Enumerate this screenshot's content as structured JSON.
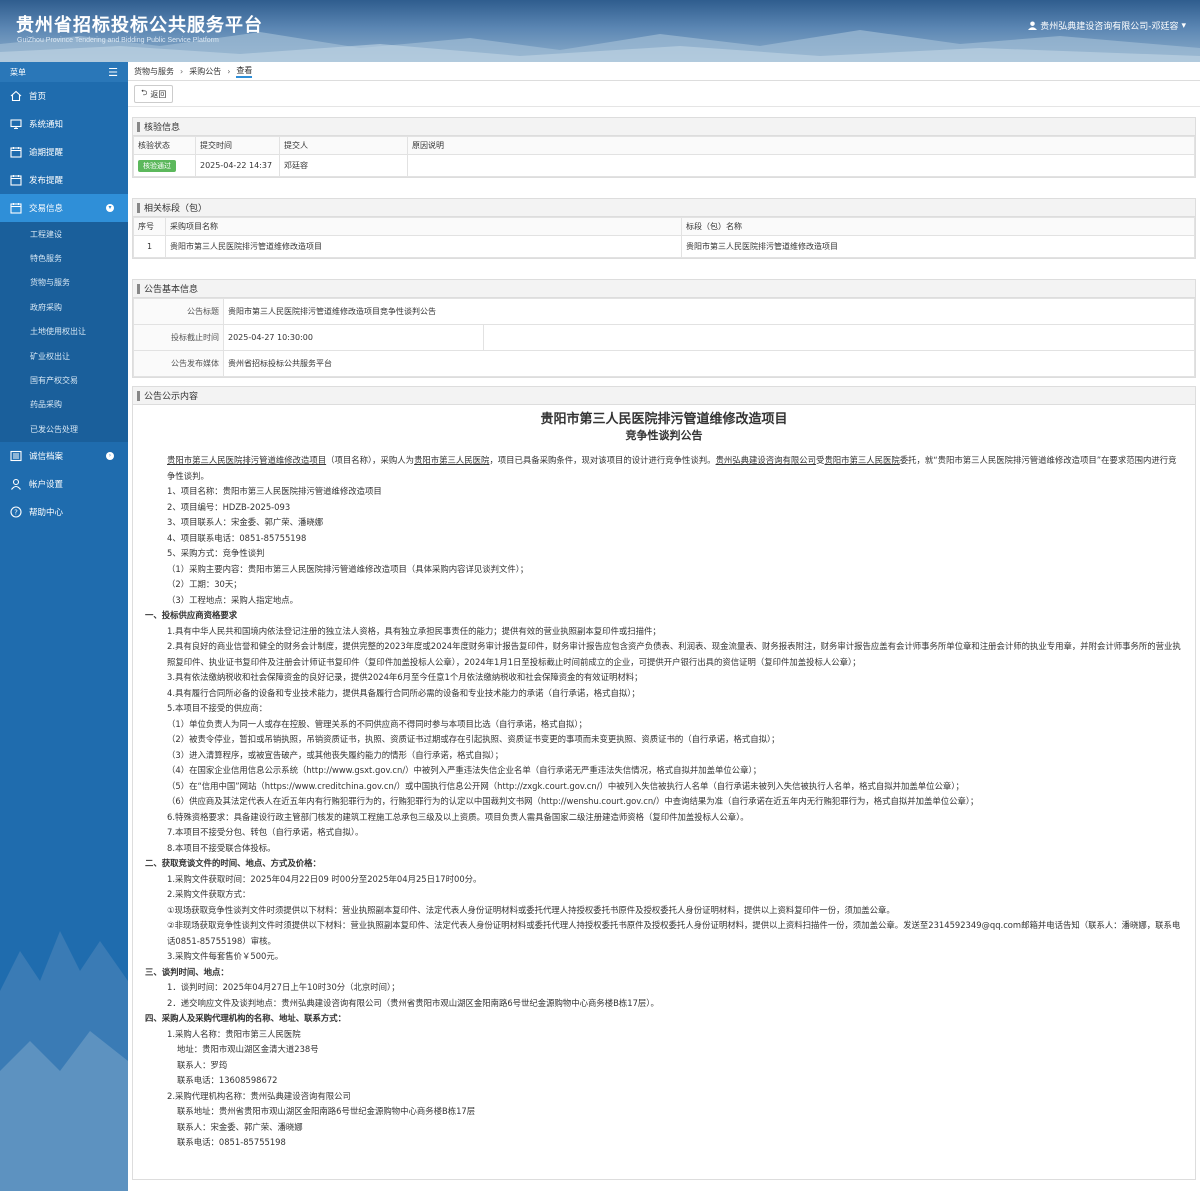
{
  "header": {
    "title_cn": "贵州省招标投标公共服务平台",
    "title_en": "GuiZhou Province Tendering and Bidding Public Service Platform",
    "user": "贵州弘典建设咨询有限公司-邓廷容"
  },
  "sidebar": {
    "menu_label": "菜单",
    "items": [
      {
        "label": "首页",
        "icon": "home-icon"
      },
      {
        "label": "系统通知",
        "icon": "monitor-icon"
      },
      {
        "label": "逾期提醒",
        "icon": "calendar-icon"
      },
      {
        "label": "发布提醒",
        "icon": "calendar-icon"
      },
      {
        "label": "交易信息",
        "icon": "calendar-icon"
      },
      {
        "label": "诚信档案",
        "icon": "list-icon"
      },
      {
        "label": "帐户设置",
        "icon": "user-icon"
      },
      {
        "label": "帮助中心",
        "icon": "help-icon"
      }
    ],
    "sub_items": [
      "工程建设",
      "特色服务",
      "货物与服务",
      "政府采购",
      "土地使用权出让",
      "矿业权出让",
      "国有产权交易",
      "药品采购",
      "已发公告处理"
    ]
  },
  "breadcrumb": [
    "货物与服务",
    "采购公告",
    "查看"
  ],
  "toolbar": {
    "back": "返回"
  },
  "verify": {
    "title": "核验信息",
    "headers": [
      "核验状态",
      "提交时间",
      "提交人",
      "原因说明"
    ],
    "status": "核验通过",
    "time": "2025-04-22 14:37",
    "person": "邓廷容",
    "reason": ""
  },
  "related": {
    "title": "相关标段（包）",
    "headers": [
      "序号",
      "采购项目名称",
      "标段（包）名称"
    ],
    "row": {
      "no": "1",
      "project": "贵阳市第三人民医院排污管道维修改造项目",
      "section": "贵阳市第三人民医院排污管道维修改造项目"
    }
  },
  "basic": {
    "title": "公告基本信息",
    "labels": [
      "公告标题",
      "投标截止时间",
      "公告发布媒体"
    ],
    "values": [
      "贵阳市第三人民医院排污管道维修改造项目竞争性谈判公告",
      "2025-04-27 10:30:00",
      "贵州省招标投标公共服务平台"
    ]
  },
  "notice": {
    "title": "公告公示内容",
    "h1": "贵阳市第三人民医院排污管道维修改造项目",
    "h2": "竞争性谈判公告",
    "intro": {
      "a": "贵阳市第三人民医院排污管道维修改造项目",
      "b": "（项目名称），采购人为",
      "c": "贵阳市第三人民医院",
      "d": "，项目已具备采购条件，现对该项目的设计进行竞争性谈判。",
      "e": "贵州弘典建设咨询有限公司",
      "f": "受",
      "g": "贵阳市第三人民医院",
      "h": "委托，就“贵阳市第三人民医院排污管道维修改造项目”在要求范围内进行竞争性谈判。"
    },
    "lines": [
      {
        "c": "i1",
        "t": "1、项目名称：贵阳市第三人民医院排污管道维修改造项目"
      },
      {
        "c": "i1",
        "t": "2、项目编号：HDZB-2025-093"
      },
      {
        "c": "i1",
        "t": "3、项目联系人：宋金委、郭广荣、潘晓娜"
      },
      {
        "c": "i1",
        "t": "4、项目联系电话：0851-85755198"
      },
      {
        "c": "i1",
        "t": "5、采购方式：竞争性谈判"
      },
      {
        "c": "i1",
        "t": "（1）采购主要内容：贵阳市第三人民医院排污管道维修改造项目（具体采购内容详见谈判文件）；"
      },
      {
        "c": "i1",
        "t": "（2）工期：30天；"
      },
      {
        "c": "i1",
        "t": "（3）工程地点：采购人指定地点。"
      },
      {
        "c": "b",
        "t": "一、投标供应商资格要求"
      },
      {
        "c": "i1",
        "t": "1.具有中华人民共和国境内依法登记注册的独立法人资格，具有独立承担民事责任的能力；提供有效的营业执照副本复印件或扫描件；"
      },
      {
        "c": "i1",
        "t": "2.具有良好的商业信誉和健全的财务会计制度，提供完整的2023年度或2024年度财务审计报告复印件，财务审计报告应包含资产负债表、利润表、现金流量表、财务报表附注，财务审计报告应盖有会计师事务所单位章和注册会计师的执业专用章，并附会计师事务所的营业执照复印件、执业证书复印件及注册会计师证书复印件（复印件加盖投标人公章），2024年1月1日至投标截止时间前成立的企业，可提供开户银行出具的资信证明（复印件加盖投标人公章）；"
      },
      {
        "c": "i1",
        "t": "3.具有依法缴纳税收和社会保障资金的良好记录，提供2024年6月至今任意1个月依法缴纳税收和社会保障资金的有效证明材料；"
      },
      {
        "c": "i1",
        "t": "4.具有履行合同所必备的设备和专业技术能力，提供具备履行合同所必需的设备和专业技术能力的承诺（自行承诺，格式自拟）；"
      },
      {
        "c": "i1",
        "t": "5.本项目不接受的供应商："
      },
      {
        "c": "i1",
        "t": "（1）单位负责人为同一人或存在控股、管理关系的不同供应商不得同时参与本项目比选（自行承诺，格式自拟）；"
      },
      {
        "c": "i1",
        "t": "（2）被责令停业，暂扣或吊销执照，吊销资质证书，执照、资质证书过期或存在引起执照、资质证书变更的事项而未变更执照、资质证书的（自行承诺，格式自拟）；"
      },
      {
        "c": "i1",
        "t": "（3）进入清算程序，或被宣告破产，或其他丧失履约能力的情形（自行承诺，格式自拟）；"
      },
      {
        "c": "i1",
        "t": "（4）在国家企业信用信息公示系统（http://www.gsxt.gov.cn/）中被列入严重违法失信企业名单（自行承诺无严重违法失信情况，格式自拟并加盖单位公章）；"
      },
      {
        "c": "i1",
        "t": "（5）在“信用中国”网站（https://www.creditchina.gov.cn/）或中国执行信息公开网（http://zxgk.court.gov.cn/）中被列入失信被执行人名单（自行承诺未被列入失信被执行人名单，格式自拟并加盖单位公章）；"
      },
      {
        "c": "i1",
        "t": "（6）供应商及其法定代表人在近五年内有行贿犯罪行为的，行贿犯罪行为的认定以中国裁判文书网（http://wenshu.court.gov.cn/）中查询结果为准（自行承诺在近五年内无行贿犯罪行为，格式自拟并加盖单位公章）；"
      },
      {
        "c": "i1",
        "t": "6.特殊资格要求：具备建设行政主管部门核发的建筑工程施工总承包三级及以上资质。项目负责人需具备国家二级注册建造师资格（复印件加盖投标人公章）。"
      },
      {
        "c": "i1",
        "t": "7.本项目不接受分包、转包（自行承诺，格式自拟）。"
      },
      {
        "c": "i1",
        "t": "8.本项目不接受联合体投标。"
      },
      {
        "c": "b",
        "t": "二、获取竞谈文件的时间、地点、方式及价格："
      },
      {
        "c": "i1",
        "t": "1.采购文件获取时间：2025年04月22日09 时00分至2025年04月25日17时00分。"
      },
      {
        "c": "i1",
        "t": "2.采购文件获取方式："
      },
      {
        "c": "i1",
        "t": "①现场获取竞争性谈判文件时须提供以下材料：营业执照副本复印件、法定代表人身份证明材料或委托代理人持授权委托书原件及授权委托人身份证明材料，提供以上资料复印件一份，须加盖公章。"
      },
      {
        "c": "i1",
        "t": "②非现场获取竞争性谈判文件时须提供以下材料：营业执照副本复印件、法定代表人身份证明材料或委托代理人持授权委托书原件及授权委托人身份证明材料，提供以上资料扫描件一份，须加盖公章。发送至2314592349@qq.com邮箱并电话告知（联系人：潘晓娜，联系电话0851-85755198）审核。"
      },
      {
        "c": "i1",
        "t": "3.采购文件每套售价￥500元。"
      },
      {
        "c": "b",
        "t": "三、谈判时间、地点："
      },
      {
        "c": "i1",
        "t": "1．谈判时间：2025年04月27日上午10时30分（北京时间）；"
      },
      {
        "c": "i1",
        "t": "2．递交响应文件及谈判地点：贵州弘典建设咨询有限公司（贵州省贵阳市观山湖区金阳南路6号世纪金源购物中心商务楼B栋17层）。"
      },
      {
        "c": "b",
        "t": "四、采购人及采购代理机构的名称、地址、联系方式："
      },
      {
        "c": "i1",
        "t": "1.采购人名称：贵阳市第三人民医院"
      },
      {
        "c": "i2",
        "t": "地址：贵阳市观山湖区金清大道238号"
      },
      {
        "c": "i2",
        "t": "联系人：罗筠"
      },
      {
        "c": "i2",
        "t": "联系电话：13608598672"
      },
      {
        "c": "i1",
        "t": "2.采购代理机构名称：贵州弘典建设咨询有限公司"
      },
      {
        "c": "i2",
        "t": "联系地址：贵州省贵阳市观山湖区金阳南路6号世纪金源购物中心商务楼B栋17层"
      },
      {
        "c": "i2",
        "t": "联系人：宋金委、郭广荣、潘晓娜"
      },
      {
        "c": "i2",
        "t": "联系电话：0851-85755198"
      }
    ]
  }
}
